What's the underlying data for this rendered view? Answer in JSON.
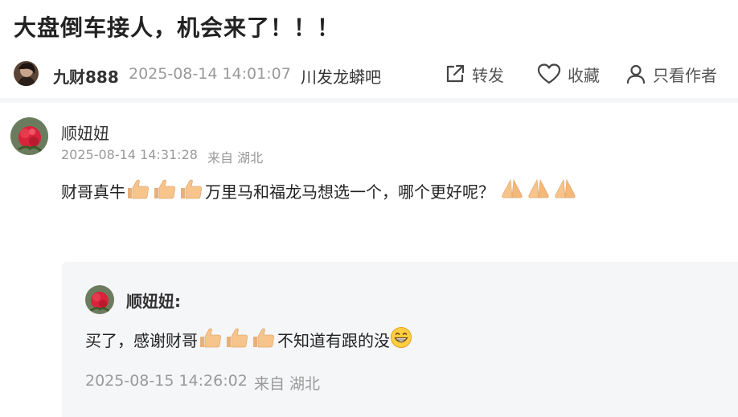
{
  "post": {
    "title": "大盘倒车接人，机会来了！！！",
    "author": "九财888",
    "time": "2025-08-14 14:01:07",
    "forum": "川发龙蟒吧"
  },
  "actions": {
    "share_label": "转发",
    "favorite_label": "收藏",
    "author_only_label": "只看作者",
    "share_icon": "share-icon",
    "favorite_icon": "heart-icon",
    "author_only_icon": "person-icon"
  },
  "comment": {
    "user": "顺妞妞",
    "time": "2025-08-14 14:31:28",
    "location": "来自 湖北",
    "text_part1": "财哥真牛",
    "text_part2": "万里马和福龙马想选一个，哪个更好呢？",
    "emoji_thumbs": "thumbs-up-emoji",
    "emoji_pray": "folded-hands-emoji"
  },
  "reply": {
    "user": "顺妞妞:",
    "text_part1": "买了，感谢财哥",
    "text_part2": "不知道有跟的没",
    "time": "2025-08-15 14:26:02",
    "location": "来自 湖北",
    "emoji_grin": "grinning-face-emoji"
  },
  "colors": {
    "text_main": "#222222",
    "text_muted": "#999999",
    "quote_bg": "#f5f6f8",
    "emoji_skin": "#f7c58c"
  }
}
